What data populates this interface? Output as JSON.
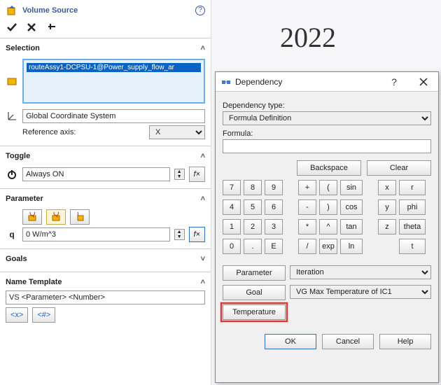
{
  "panel": {
    "title": "Volume Source",
    "selection": {
      "heading": "Selection",
      "item": "routeAssy1-DCPSU-1@Power_supply_flow_ar",
      "cs": "Global Coordinate System",
      "refAxisLabel": "Reference axis:",
      "refAxisValue": "X"
    },
    "toggle": {
      "heading": "Toggle",
      "value": "Always ON"
    },
    "parameter": {
      "heading": "Parameter",
      "value": "0 W/m^3",
      "q": "q"
    },
    "goals": {
      "heading": "Goals"
    },
    "nameTpl": {
      "heading": "Name Template",
      "value": "VS <Parameter> <Number>"
    }
  },
  "year": "2022",
  "dlg": {
    "title": "Dependency",
    "help": "?",
    "depTypeLabel": "Dependency type:",
    "depTypeValue": "Formula Definition",
    "formulaLabel": "Formula:",
    "formulaValue": "",
    "backspace": "Backspace",
    "clear": "Clear",
    "calc": {
      "r1": [
        "7",
        "8",
        "9",
        "+",
        "(",
        "sin",
        "x",
        "r"
      ],
      "r2": [
        "4",
        "5",
        "6",
        "-",
        ")",
        "cos",
        "y",
        "phi"
      ],
      "r3": [
        "1",
        "2",
        "3",
        "*",
        "^",
        "tan",
        "z",
        "theta"
      ],
      "r4": [
        "0",
        ".",
        "E",
        "/",
        "exp",
        "ln",
        "",
        "t"
      ]
    },
    "paramBtn": "Parameter",
    "paramSel": "Iteration",
    "goalBtn": "Goal",
    "goalSel": "VG Max Temperature of IC1",
    "tempBtn": "Temperature",
    "ok": "OK",
    "cancel": "Cancel",
    "helpBtn": "Help"
  }
}
